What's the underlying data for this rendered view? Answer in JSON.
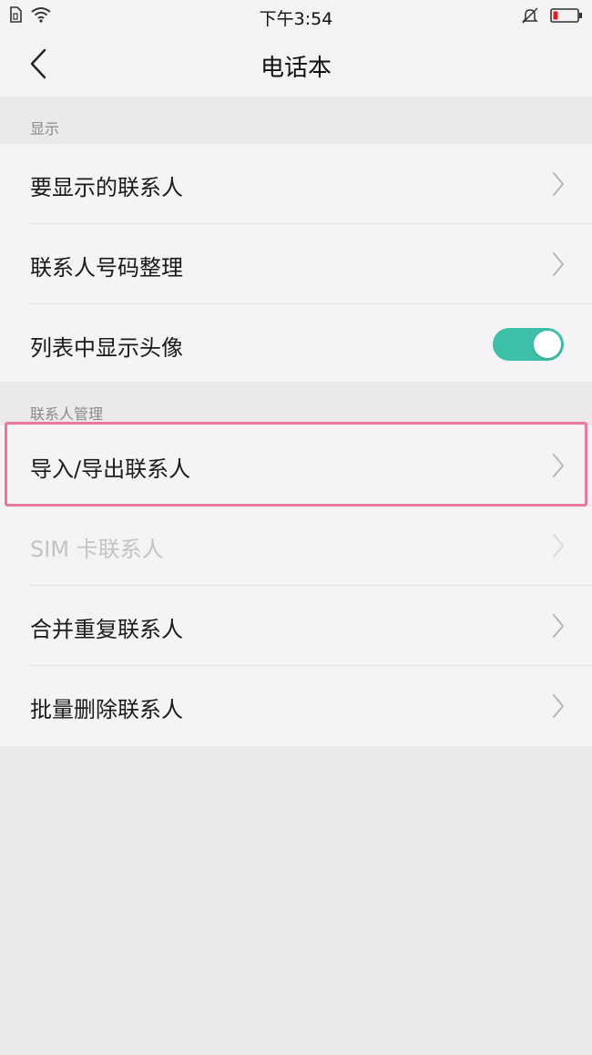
{
  "status_bar": {
    "time": "下午3:54",
    "left_icons": [
      "sim-icon",
      "wifi-icon"
    ],
    "right_icons": [
      "silent-bell-icon",
      "battery-icon"
    ],
    "battery_color": "#e02020"
  },
  "header": {
    "back_icon": "chevron-left-icon",
    "title": "电话本"
  },
  "sections": [
    {
      "title": "显示",
      "rows": [
        {
          "label": "要显示的联系人",
          "control": "chevron"
        },
        {
          "label": "联系人号码整理",
          "control": "chevron"
        },
        {
          "label": "列表中显示头像",
          "control": "toggle",
          "toggle_on": true
        }
      ]
    },
    {
      "title": "联系人管理",
      "rows": [
        {
          "label": "导入/导出联系人",
          "control": "chevron",
          "highlighted": true
        },
        {
          "label": "SIM 卡联系人",
          "control": "chevron",
          "disabled": true
        },
        {
          "label": "合并重复联系人",
          "control": "chevron"
        },
        {
          "label": "批量删除联系人",
          "control": "chevron"
        }
      ]
    }
  ],
  "colors": {
    "toggle_on": "#3dbfa8",
    "highlight_border": "#e8789e",
    "background": "#ebe9eb",
    "row_background": "#f5f3f5"
  }
}
